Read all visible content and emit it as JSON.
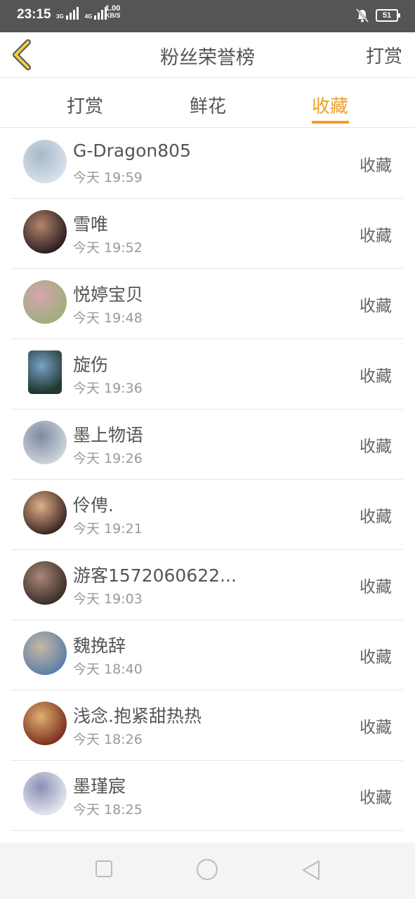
{
  "status_bar": {
    "time": "23:15",
    "net1": "3G",
    "net2": "4G",
    "speed_value": "1.00",
    "speed_unit": "KB/S",
    "battery": "51"
  },
  "header": {
    "back_icon": "chevron-left-icon",
    "title": "粉丝荣誉榜",
    "action_label": "打赏"
  },
  "tabs": [
    {
      "label": "打赏",
      "active": false
    },
    {
      "label": "鲜花",
      "active": false
    },
    {
      "label": "收藏",
      "active": true
    }
  ],
  "list": [
    {
      "name": "G-Dragon805",
      "time": "今天 19:59",
      "action": "收藏",
      "colors": [
        "#d6e2ec",
        "#a9b9c8"
      ]
    },
    {
      "name": "雪唯",
      "time": "今天 19:52",
      "action": "收藏",
      "colors": [
        "#2b1c22",
        "#b4866b"
      ]
    },
    {
      "name": "悦婷宝贝",
      "time": "今天 19:48",
      "action": "收藏",
      "colors": [
        "#9bb07a",
        "#d9a3b3"
      ]
    },
    {
      "name": "旋伤",
      "time": "今天 19:36",
      "action": "收藏",
      "colors": [
        "#223a33",
        "#7aa2c8"
      ]
    },
    {
      "name": "墨上物语",
      "time": "今天 19:26",
      "action": "收藏",
      "colors": [
        "#cfd4dc",
        "#7d8ba0"
      ]
    },
    {
      "name": "伶俜.",
      "time": "今天 19:21",
      "action": "收藏",
      "colors": [
        "#3a2520",
        "#e0b08a"
      ]
    },
    {
      "name": "游客1572060622...",
      "time": "今天 19:03",
      "action": "收藏",
      "colors": [
        "#3b2c28",
        "#a98778"
      ]
    },
    {
      "name": "魏挽辞",
      "time": "今天 18:40",
      "action": "收藏",
      "colors": [
        "#5d7fa8",
        "#c6b8a3"
      ]
    },
    {
      "name": "浅念.抱紧甜热热",
      "time": "今天 18:26",
      "action": "收藏",
      "colors": [
        "#7a2e1e",
        "#e0b070"
      ]
    },
    {
      "name": "墨瑾宸",
      "time": "今天 18:25",
      "action": "收藏",
      "colors": [
        "#e6e8ef",
        "#8a8fb5"
      ]
    }
  ],
  "nav": {
    "recent_icon": "square-icon",
    "home_icon": "circle-icon",
    "back_icon": "triangle-back-icon"
  },
  "colors": {
    "accent": "#f0a020",
    "status_bar": "#555555",
    "divider": "#e5e5e5"
  }
}
